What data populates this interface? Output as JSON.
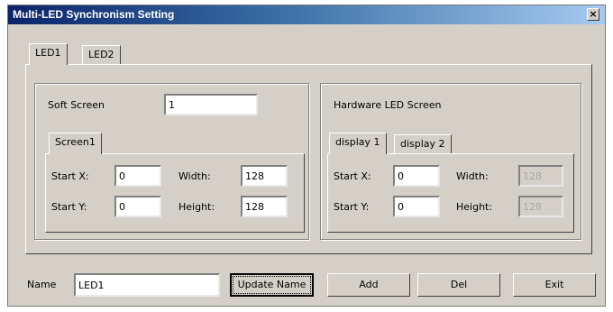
{
  "window": {
    "title": "Multi-LED Synchronism Setting",
    "close_glyph": "×"
  },
  "led_tabs": [
    {
      "label": "LED1",
      "active": true
    },
    {
      "label": "LED2",
      "active": false
    }
  ],
  "soft": {
    "label": "Soft Screen",
    "value": "1",
    "tabs": [
      {
        "label": "Screen1",
        "active": true
      }
    ],
    "start_x_label": "Start X:",
    "start_x": "0",
    "start_y_label": "Start Y:",
    "start_y": "0",
    "width_label": "Width:",
    "width": "128",
    "height_label": "Height:",
    "height": "128"
  },
  "hardware": {
    "label": "Hardware LED Screen",
    "tabs": [
      {
        "label": "display 1",
        "active": true
      },
      {
        "label": "display 2",
        "active": false
      }
    ],
    "start_x_label": "Start X:",
    "start_x": "0",
    "start_y_label": "Start Y:",
    "start_y": "0",
    "width_label": "Width:",
    "width": "128",
    "height_label": "Height:",
    "height": "128"
  },
  "bottom": {
    "name_label": "Name",
    "name_value": "LED1",
    "update_label": "Update Name",
    "add_label": "Add",
    "del_label": "Del",
    "exit_label": "Exit"
  }
}
